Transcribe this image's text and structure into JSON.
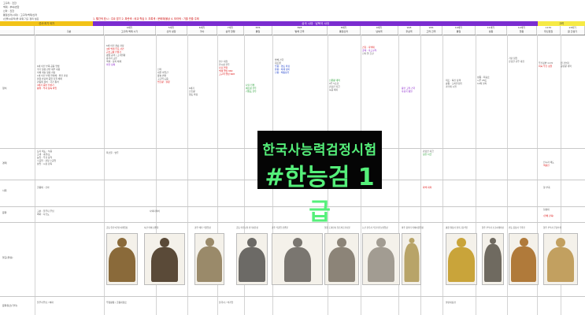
{
  "notes": {
    "lines": [
      "고구려 : 진한",
      "백제 : 부여/변한",
      "신라 : 진한",
      "통일신라(시대) : 고구려/백제/신라",
      "  (인물)/(유적)을 외워 기출 정리 필요"
    ]
  },
  "legend": "1. 빨간색 표시 : 주요 암기   2. 파란색 : 비교 학습   3. 초록색 : 문화재/불상   4. 보라색 : 기출 빈출 주제",
  "bands": {
    "left": "선사·초기 국가",
    "middle": "삼국 시대 · 남북국 시대",
    "right": "고려"
  },
  "years": [
    "",
    "",
    "4세기",
    "5세기",
    "6세기",
    "7세기",
    "676",
    "698",
    "8세기",
    "9세기",
    "918",
    "936",
    "10세기",
    "11세기",
    "12세기",
    "1170",
    "13세기"
  ],
  "headers": [
    "",
    "구분",
    "고구려·백제 시기",
    "신라 성장",
    "가야",
    "삼국 항쟁",
    "통일",
    "발해 건국",
    "통일신라",
    "남북국",
    "후삼국",
    "고려 건국",
    "통일",
    "성종",
    "현종",
    "무신정권",
    "원 간섭기"
  ],
  "rows": {
    "politics": "정치",
    "economy": "경제",
    "society": "사회",
    "culture": "문화",
    "buddhism": "불교(불상)",
    "arts": "문화유산(기타)"
  },
  "politics": {
    "c1": [
      "6세 이전 부족 공동 연맹",
      "국가 형성 관련 세부 내용",
      "지배 계층 형성 과정",
      "",
      "1세 이전 부족 연맹체 : 발전 과정",
      "율령 반포와 중앙 집권 체제",
      "관등제 정비 : 국가 통치",
      "",
      "4세기 중반 전성기",
      "왕위 : 부자 상속 확립"
    ],
    "c2": [
      "6세 이전 계승 과정",
      "4세 백제 주요 사건",
      "근초고왕 전성기",
      "",
      "평양 공격 / 고국원왕",
      "중국과 교류",
      "",
      "백제 : 정치 체제",
      "마한 정복"
    ],
    "c3": [
      "신라",
      "내물 마립간",
      "왕호 변화",
      "",
      "고구려 도움",
      "",
      "법흥왕 : 율령"
    ],
    "c4": [
      "6세기",
      "진흥왕",
      "영토 확장"
    ],
    "c5": [
      "살수 대첩",
      "안시성 전투",
      "",
      "나당 연합",
      "백제 멸망 660",
      "고구려 멸망 668"
    ],
    "c6": [
      "나당 전쟁",
      "매소성 전투",
      "기벌포 전투"
    ],
    "c7": [
      "발해 건국",
      "대조영",
      "",
      "무왕 : 영토 확장",
      "문왕 : 체제 정비",
      "선왕 : 해동성국"
    ],
    "c8": [
      "신문왕 개혁",
      "9주 5소경",
      "관료전 지급",
      "녹읍 폐지"
    ],
    "c9": [
      "견훤 : 후백제",
      "궁예 : 후고구려",
      "",
      "신라 말 혼란"
    ],
    "c10": [
      "왕건 고려 건국",
      "후삼국 통일"
    ],
    "c11": [
      "태조 : 북진 정책",
      "광종 : 노비안검법",
      "과거제 시행"
    ],
    "c12": [
      "성종 : 최승로",
      "시무 28조",
      "12목 설치"
    ],
    "c13": [
      "거란 침입",
      "강감찬 귀주 대첩"
    ],
    "c14": [
      "무신정변 1170",
      "최씨 무신 정권"
    ],
    "c15": [
      "원 간섭기",
      "공민왕 개혁"
    ]
  },
  "economy": {
    "c1": [
      "토지 제도 : 식읍",
      "조세 : 곡물/포",
      "",
      "농업 : 우경 장려",
      "수공업 : 관청 수공업",
      "상업 : 시장 감독"
    ],
    "c2": [
      "특산물 : 명주"
    ],
    "c3": [
      "관료전 지급",
      "정전 지급"
    ],
    "c4": [
      "전시과 제도",
      "역분전"
    ]
  },
  "society": {
    "c1": [
      "골품제 : 신라"
    ],
    "c2": [
      "화백 회의"
    ],
    "c3": [
      "향·부곡"
    ]
  },
  "culture": {
    "c1": [
      "고분 : 돌무지 무덤",
      "벽화 : 사신도"
    ],
    "c2": [
      "사택지적비"
    ],
    "c3": [
      "첨성대"
    ],
    "c4": [
      "(천체 관측)"
    ]
  },
  "buddhism_caps": [
    "금동 연가7년명 여래입상",
    "서산 마애 삼존불",
    "경주 배리 석불입상",
    "금동 미륵보살 반가사유상",
    "경주 석굴암 본존불",
    "철원 도피안사 철조비로자나불",
    "논산 관촉사 석조미륵보살입상",
    "파주 용미리 마애이불입상",
    "평창 월정사 팔각구층석탑",
    "영주 부석사 소조여래좌상",
    "안동 봉정사 극락전",
    "영주 부석사 무량수전"
  ],
  "arts": [
    "돌무지무덤 / 벽화",
    "무령왕릉 / 금동대향로",
    "불국사 / 석가탑",
    "팔만대장경"
  ],
  "badge": {
    "line1": "한국사능력검정시험",
    "line2": "#한능검 1급"
  },
  "colors": {
    "purple_band": "#7b2dd0",
    "yellow_band": "#f2c318",
    "badge_bg": "#050505",
    "badge_text": "#55f07a",
    "key_red": "#d11111"
  }
}
